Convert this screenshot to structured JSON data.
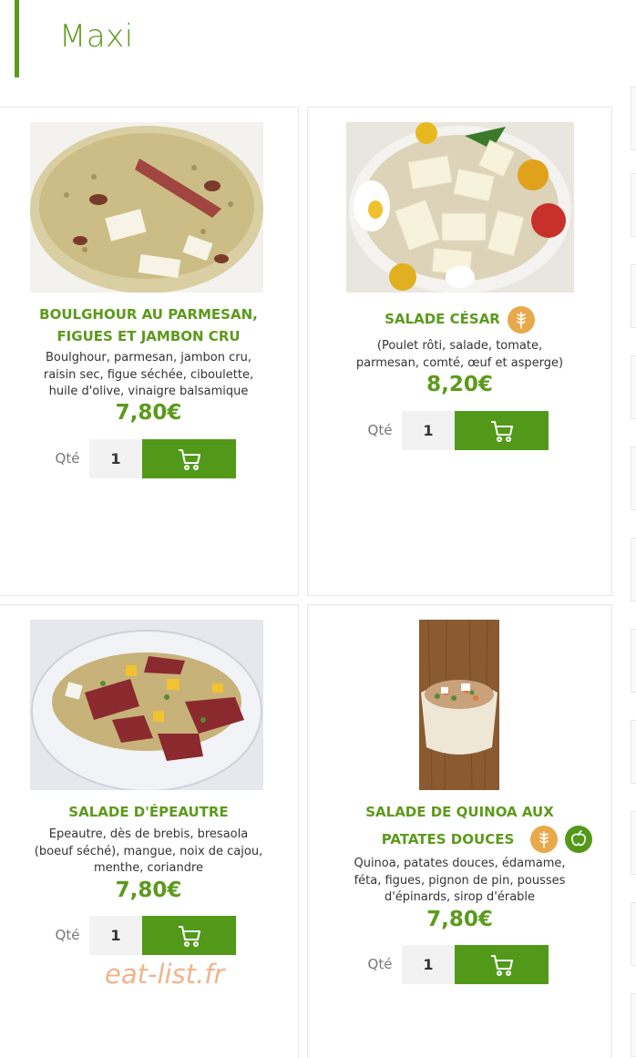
{
  "section": {
    "title": "Maxi"
  },
  "products": [
    {
      "title_line1": "BOULGHOUR AU PARMESAN,",
      "title_line2": "FIGUES ET JAMBON CRU",
      "desc_line1": "Boulghour, parmesan, jambon cru,",
      "desc_line2": "raisin sec, figue séchée, ciboulette,",
      "desc_line3": "huile d'olive, vinaigre balsamique",
      "price": "7,80€",
      "qty_label": "Qté",
      "qty_value": "1",
      "badges": []
    },
    {
      "title_line1": "SALADE CÉSAR",
      "desc_line1": "(Poulet rôti, salade, tomate,",
      "desc_line2": "parmesan, comté, œuf et asperge)",
      "price": "8,20€",
      "qty_label": "Qté",
      "qty_value": "1",
      "badges": [
        "gluten-icon"
      ]
    },
    {
      "title_line1": "SALADE D'ÉPEAUTRE",
      "desc_line1": "Epeautre, dès de brebis, bresaola",
      "desc_line2": "(boeuf séché), mangue, noix de cajou,",
      "desc_line3": "menthe, coriandre",
      "price": "7,80€",
      "qty_label": "Qté",
      "qty_value": "1",
      "badges": []
    },
    {
      "title_line1": "SALADE DE QUINOA AUX",
      "title_line2": "PATATES DOUCES",
      "desc_line1": "Quinoa, patates douces, édamame,",
      "desc_line2": "féta, figues, pignon de pin, pousses",
      "desc_line3": "d'épinards, sirop d'érable",
      "price": "7,80€",
      "qty_label": "Qté",
      "qty_value": "1",
      "badges": [
        "gluten-icon",
        "vegan-icon"
      ]
    }
  ],
  "watermark": "eat-list.fr",
  "colors": {
    "brand_green": "#5c9a1b",
    "button_green": "#52991a",
    "gluten_badge": "#e8a94a",
    "watermark": "#f0b48c"
  }
}
